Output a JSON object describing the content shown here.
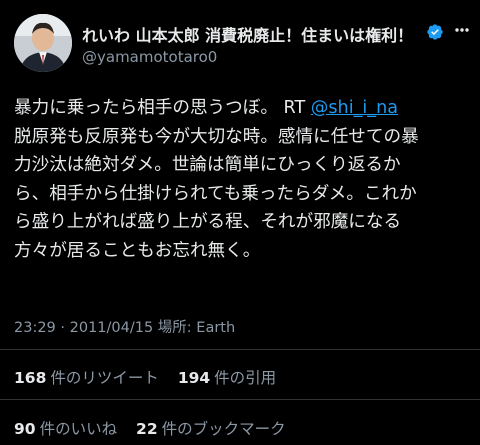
{
  "profile": {
    "display_name": "れいわ 山本太郎 消費税廃止！住まいは権利！",
    "handle": "@yamamototaro0",
    "verified": true,
    "verified_icon": "verified-badge-icon",
    "verified_color": "#1d9bf0"
  },
  "tweet": {
    "line1_text": "暴力に乗ったら相手の思うつぼ。 RT ",
    "mention": "@shi_i_na",
    "lines": [
      "脱原発も反原発も今が大切な時。感情に任せての暴",
      "力沙汰は絶対ダメ。世論は簡単にひっくり返るか",
      "ら、相手から仕掛けられても乗ったらダメ。これか",
      "ら盛り上がれば盛り上がる程、それが邪魔になる",
      "方々が居ることもお忘れ無く。"
    ]
  },
  "meta": {
    "text": "23:29 · 2011/04/15 場所: Earth"
  },
  "stats": {
    "retweets": {
      "count": "168",
      "label": "件のリツイート"
    },
    "quotes": {
      "count": "194",
      "label": "件の引用"
    },
    "likes": {
      "count": "90",
      "label": "件のいいね"
    },
    "bookmarks": {
      "count": "22",
      "label": "件のブックマーク"
    }
  },
  "colors": {
    "background": "#000000",
    "text": "#e7e9ea",
    "secondary": "#8b98a5",
    "link": "#1d9bf0",
    "divider": "#2f3336"
  }
}
